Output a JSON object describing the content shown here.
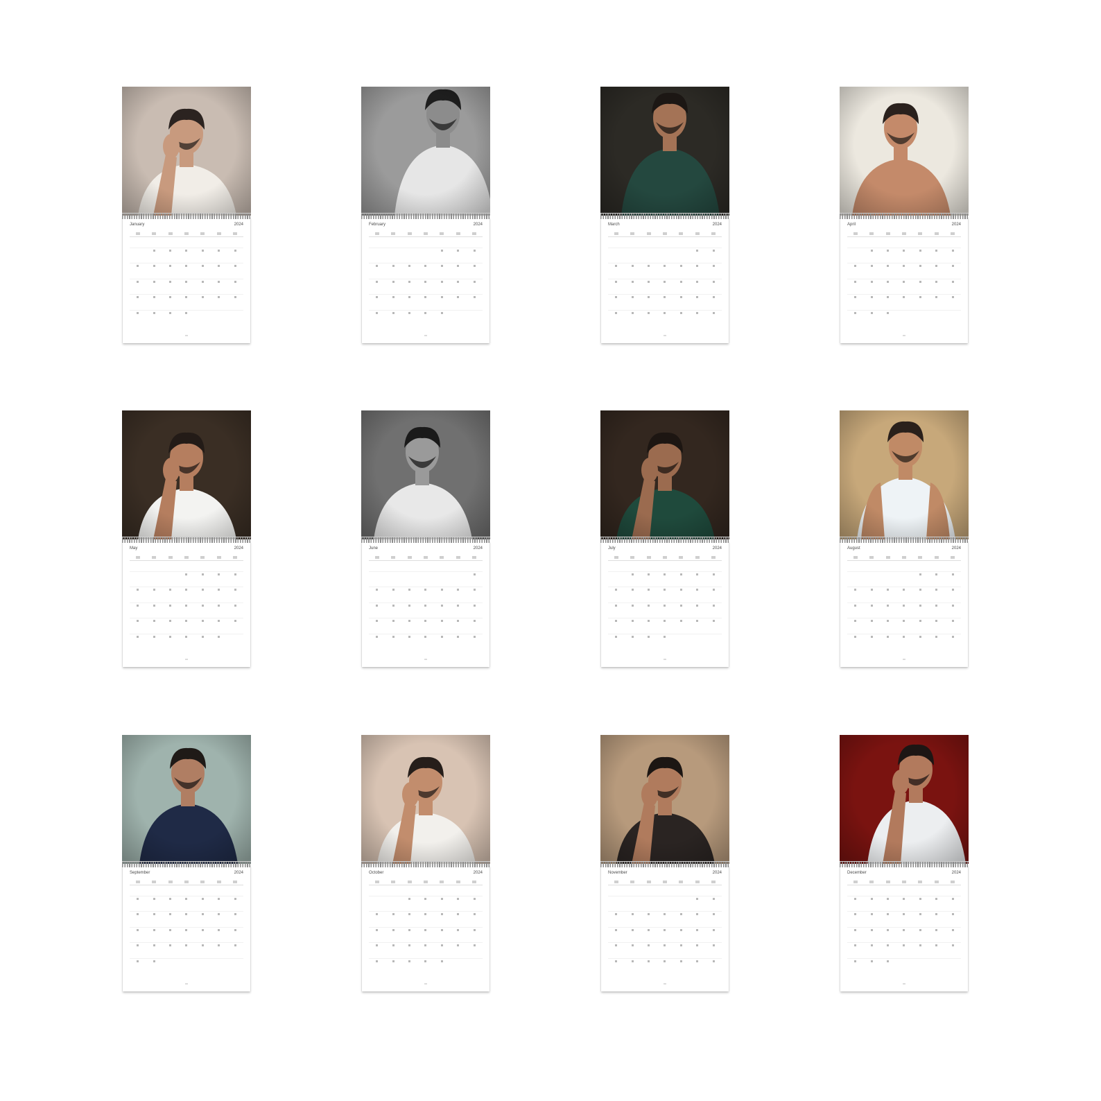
{
  "calendars": [
    {
      "month": "January",
      "year": "2024",
      "photo": {
        "bg": "#c9bcb2",
        "skin": "#c89a7e",
        "hair": "#2b2320",
        "shirt": "#f1ede7",
        "pose": "hand-on-face"
      }
    },
    {
      "month": "February",
      "year": "2024",
      "photo": {
        "bg": "#9b9b9b",
        "skin": "#8c8c8c",
        "hair": "#1e1e1e",
        "shirt": "#e6e6e6",
        "pose": "reclining"
      }
    },
    {
      "month": "March",
      "year": "2024",
      "photo": {
        "bg": "#2c2a25",
        "skin": "#a47356",
        "hair": "#1c1714",
        "shirt": "#24483f",
        "pose": "seated"
      }
    },
    {
      "month": "April",
      "year": "2024",
      "photo": {
        "bg": "#ece8df",
        "skin": "#c48a6a",
        "hair": "#2a211d",
        "shirt": "#c48a6a",
        "pose": "close-up"
      }
    },
    {
      "month": "May",
      "year": "2024",
      "photo": {
        "bg": "#3a2e24",
        "skin": "#b57e5f",
        "hair": "#231b17",
        "shirt": "#f3f3f1",
        "pose": "hand-on-face"
      }
    },
    {
      "month": "June",
      "year": "2024",
      "photo": {
        "bg": "#707070",
        "skin": "#9a9a9a",
        "hair": "#1a1a1a",
        "shirt": "#e8e8e8",
        "pose": "close-up"
      }
    },
    {
      "month": "July",
      "year": "2024",
      "photo": {
        "bg": "#33271f",
        "skin": "#9b6b4f",
        "hair": "#1d1612",
        "shirt": "#1f4a3c",
        "pose": "hand-on-face"
      }
    },
    {
      "month": "August",
      "year": "2024",
      "photo": {
        "bg": "#c7a87a",
        "skin": "#c08a66",
        "hair": "#2a201b",
        "shirt": "#eef3f6",
        "pose": "tank"
      }
    },
    {
      "month": "September",
      "year": "2024",
      "photo": {
        "bg": "#9fb3ad",
        "skin": "#b07e63",
        "hair": "#1f1a17",
        "shirt": "#1f2a46",
        "pose": "standing"
      }
    },
    {
      "month": "October",
      "year": "2024",
      "photo": {
        "bg": "#d8c3b3",
        "skin": "#c28d6d",
        "hair": "#261e1a",
        "shirt": "#f2f0ec",
        "pose": "hands"
      }
    },
    {
      "month": "November",
      "year": "2024",
      "photo": {
        "bg": "#b79a7c",
        "skin": "#b07b5d",
        "hair": "#1c1613",
        "shirt": "#2a2422",
        "pose": "hands"
      }
    },
    {
      "month": "December",
      "year": "2024",
      "photo": {
        "bg": "#7a1310",
        "skin": "#b27a5d",
        "hair": "#1d1614",
        "shirt": "#eceef0",
        "pose": "red"
      }
    }
  ]
}
